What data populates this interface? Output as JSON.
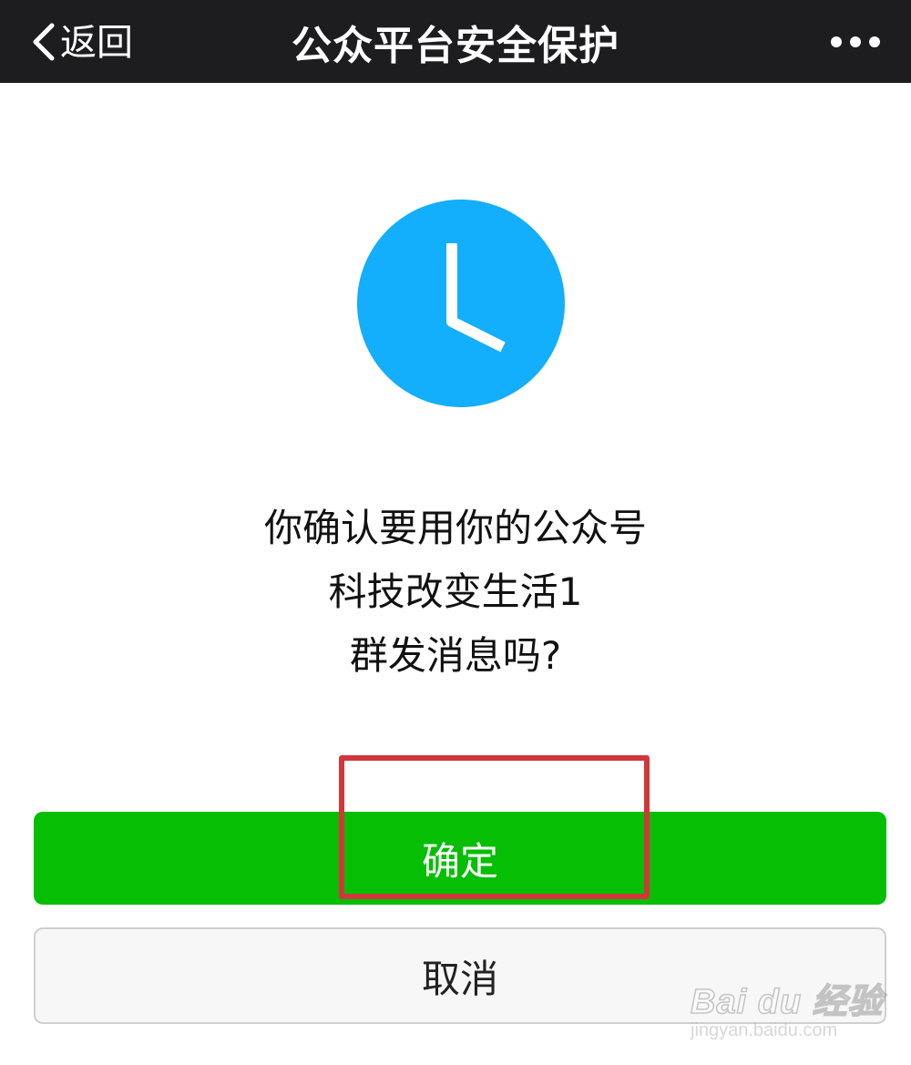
{
  "navbar": {
    "back_label": "返回",
    "title": "公众平台安全保护",
    "more_icon": "more-dots-icon"
  },
  "main": {
    "icon": "clock-icon",
    "icon_color": "#13aefc",
    "message_lines": [
      "你确认要用你的公众号",
      "科技改变生活1",
      "群发消息吗?"
    ]
  },
  "actions": {
    "confirm_label": "确定",
    "confirm_color": "#06be04",
    "cancel_label": "取消"
  },
  "annotation": {
    "highlight_color": "#d1373a"
  },
  "watermark": {
    "main_text": "Bai du 经验",
    "sub_text": "jingyan.baidu.com"
  }
}
